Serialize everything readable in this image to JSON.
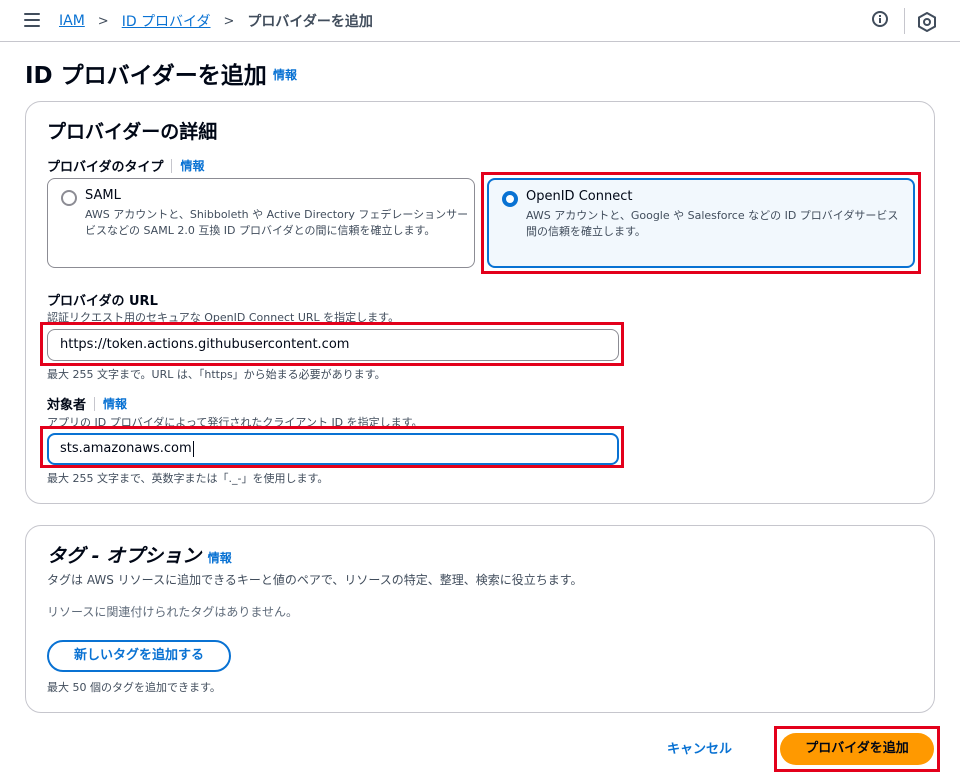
{
  "breadcrumbs": {
    "items": [
      "IAM",
      "ID プロバイダ"
    ],
    "current": "プロバイダーを追加",
    "separator": ">"
  },
  "page": {
    "title": "ID プロバイダーを追加",
    "info": "情報"
  },
  "provider_details": {
    "title": "プロバイダーの詳細",
    "type_label": "プロバイダのタイプ",
    "type_info": "情報",
    "options": [
      {
        "title": "SAML",
        "desc": "AWS アカウントと、Shibboleth や Active Directory フェデレーションサービスなどの SAML 2.0 互換 ID プロバイダとの間に信頼を確立します。",
        "selected": false
      },
      {
        "title": "OpenID Connect",
        "desc": "AWS アカウントと、Google や Salesforce などの ID プロバイダサービス間の信頼を確立します。",
        "selected": true
      }
    ],
    "url_label": "プロバイダの URL",
    "url_desc": "認証リクエスト用のセキュアな OpenID Connect URL を指定します。",
    "url_value": "https://token.actions.githubusercontent.com",
    "url_hint": "最大 255 文字まで。URL は、「https」から始まる必要があります。",
    "audience_label": "対象者",
    "audience_info": "情報",
    "audience_desc": "アプリの ID プロバイダによって発行されたクライアント ID を指定します。",
    "audience_value": "sts.amazonaws.com",
    "audience_hint": "最大 255 文字まで、英数字または「._-」を使用します。"
  },
  "tags": {
    "title": "タグ - オプション",
    "info": "情報",
    "desc": "タグは AWS リソースに追加できるキーと値のペアで、リソースの特定、整理、検索に役立ちます。",
    "empty": "リソースに関連付けられたタグはありません。",
    "add_button": "新しいタグを追加する",
    "limit": "最大 50 個のタグを追加できます。"
  },
  "actions": {
    "cancel": "キャンセル",
    "submit": "プロバイダを追加"
  },
  "colors": {
    "link": "#0972d3",
    "primary_button": "#ff9900",
    "highlight": "#e3001b",
    "selected_tile_bg": "#f2f8fd"
  },
  "icons": [
    "menu-icon",
    "info-circle-icon",
    "hexagon-icon",
    "chevron-right-icon",
    "radio-icon"
  ]
}
